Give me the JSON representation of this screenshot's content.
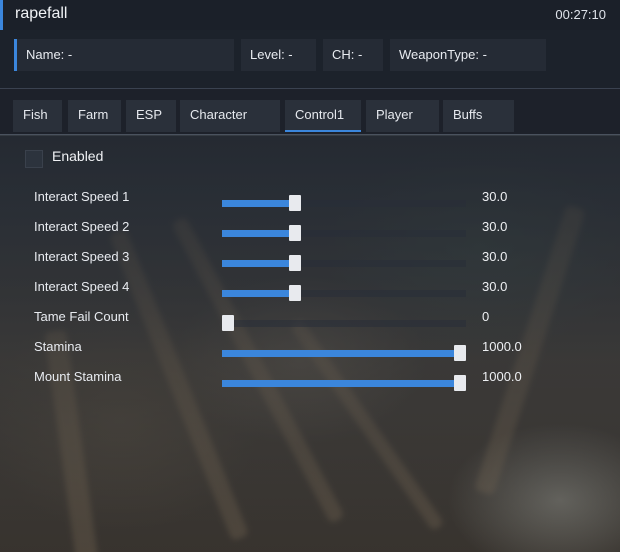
{
  "window": {
    "title": "rapefall",
    "clock": "00:27:10"
  },
  "info": {
    "name": "Name: -",
    "level": "Level: -",
    "ch": "CH: -",
    "weapon_type": "WeaponType: -"
  },
  "tabs": [
    {
      "label": "Fish"
    },
    {
      "label": "Farm"
    },
    {
      "label": "ESP"
    },
    {
      "label": "Character"
    },
    {
      "label": "Control1",
      "active": true
    },
    {
      "label": "Player"
    },
    {
      "label": "Buffs"
    }
  ],
  "enabled": {
    "label": "Enabled",
    "checked": false
  },
  "sliders": [
    {
      "label": "Interact Speed 1",
      "value": "30.0",
      "fraction": 0.29
    },
    {
      "label": "Interact Speed 2",
      "value": "30.0",
      "fraction": 0.29
    },
    {
      "label": "Interact Speed 3",
      "value": "30.0",
      "fraction": 0.29
    },
    {
      "label": "Interact Speed 4",
      "value": "30.0",
      "fraction": 0.29
    },
    {
      "label": "Tame Fail Count",
      "value": "0",
      "fraction": 0.0
    },
    {
      "label": "Stamina",
      "value": "1000.0",
      "fraction": 1.0
    },
    {
      "label": "Mount Stamina",
      "value": "1000.0",
      "fraction": 1.0
    }
  ],
  "colors": {
    "accent": "#3b86dc",
    "panel": "#1c222b",
    "cell": "#252b35"
  }
}
